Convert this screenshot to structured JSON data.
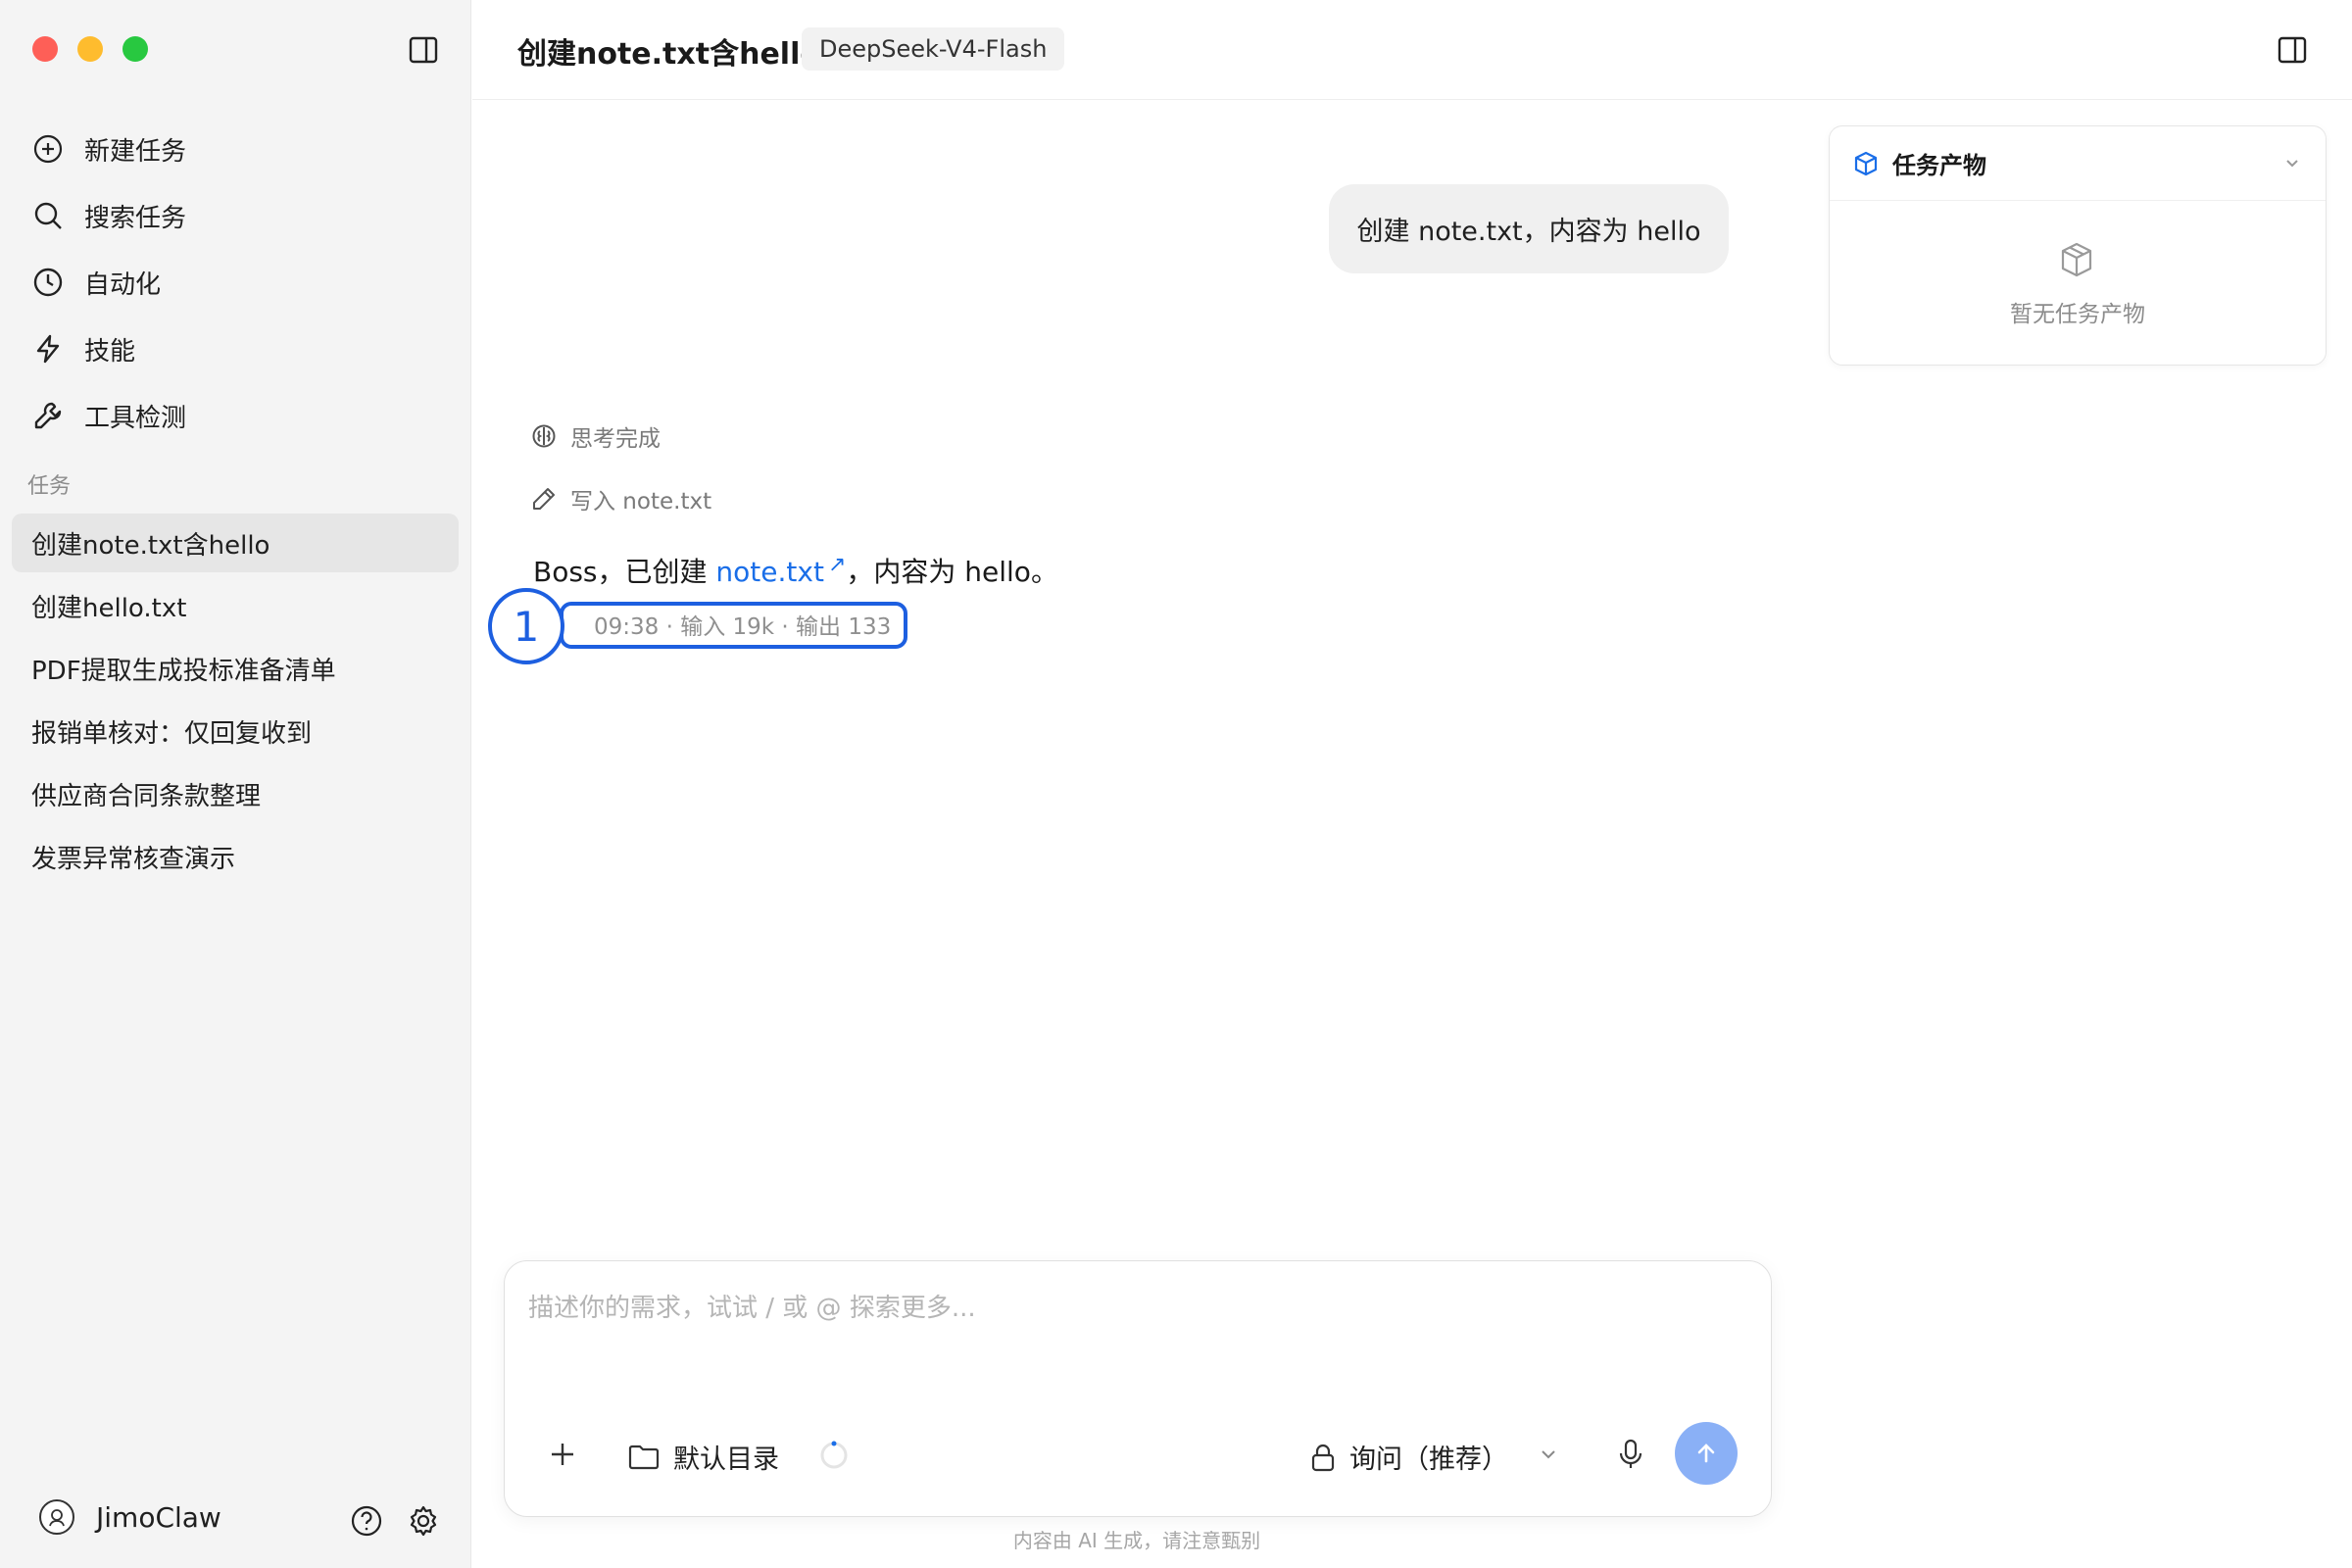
{
  "sidebar": {
    "nav": [
      {
        "label": "新建任务",
        "icon": "plus-circle-icon"
      },
      {
        "label": "搜索任务",
        "icon": "search-icon"
      },
      {
        "label": "自动化",
        "icon": "clock-icon"
      },
      {
        "label": "技能",
        "icon": "lightning-icon"
      },
      {
        "label": "工具检测",
        "icon": "wrench-icon"
      }
    ],
    "section_label": "任务",
    "tasks": [
      {
        "label": "创建note.txt含hello",
        "active": true
      },
      {
        "label": "创建hello.txt"
      },
      {
        "label": "PDF提取生成投标准备清单"
      },
      {
        "label": "报销单核对：仅回复收到"
      },
      {
        "label": "供应商合同条款整理"
      },
      {
        "label": "发票异常核查演示"
      }
    ],
    "user": {
      "name": "JimoClaw"
    }
  },
  "header": {
    "title": "创建note.txt含hello",
    "model": "DeepSeek-V4-Flash"
  },
  "artifacts": {
    "title": "任务产物",
    "empty_text": "暂无任务产物"
  },
  "chat": {
    "user_message": "创建 note.txt，内容为 hello",
    "steps": {
      "think": "思考完成",
      "write": "写入 note.txt"
    },
    "answer": {
      "prefix": "Boss，已创建 ",
      "link": "note.txt",
      "suffix": "，内容为 hello。"
    },
    "meta": "09:38 · 输入 19k · 输出 133",
    "marker": "1"
  },
  "composer": {
    "placeholder": "描述你的需求，试试 / 或 @ 探索更多...",
    "folder": "默认目录",
    "mode": "询问（推荐）"
  },
  "disclaimer": "内容由 AI 生成，请注意甄别",
  "colors": {
    "accent": "#1a6ee8",
    "marker": "#1d5fe0",
    "send_button": "#8ab0f6",
    "sidebar_bg": "#f4f4f4"
  }
}
